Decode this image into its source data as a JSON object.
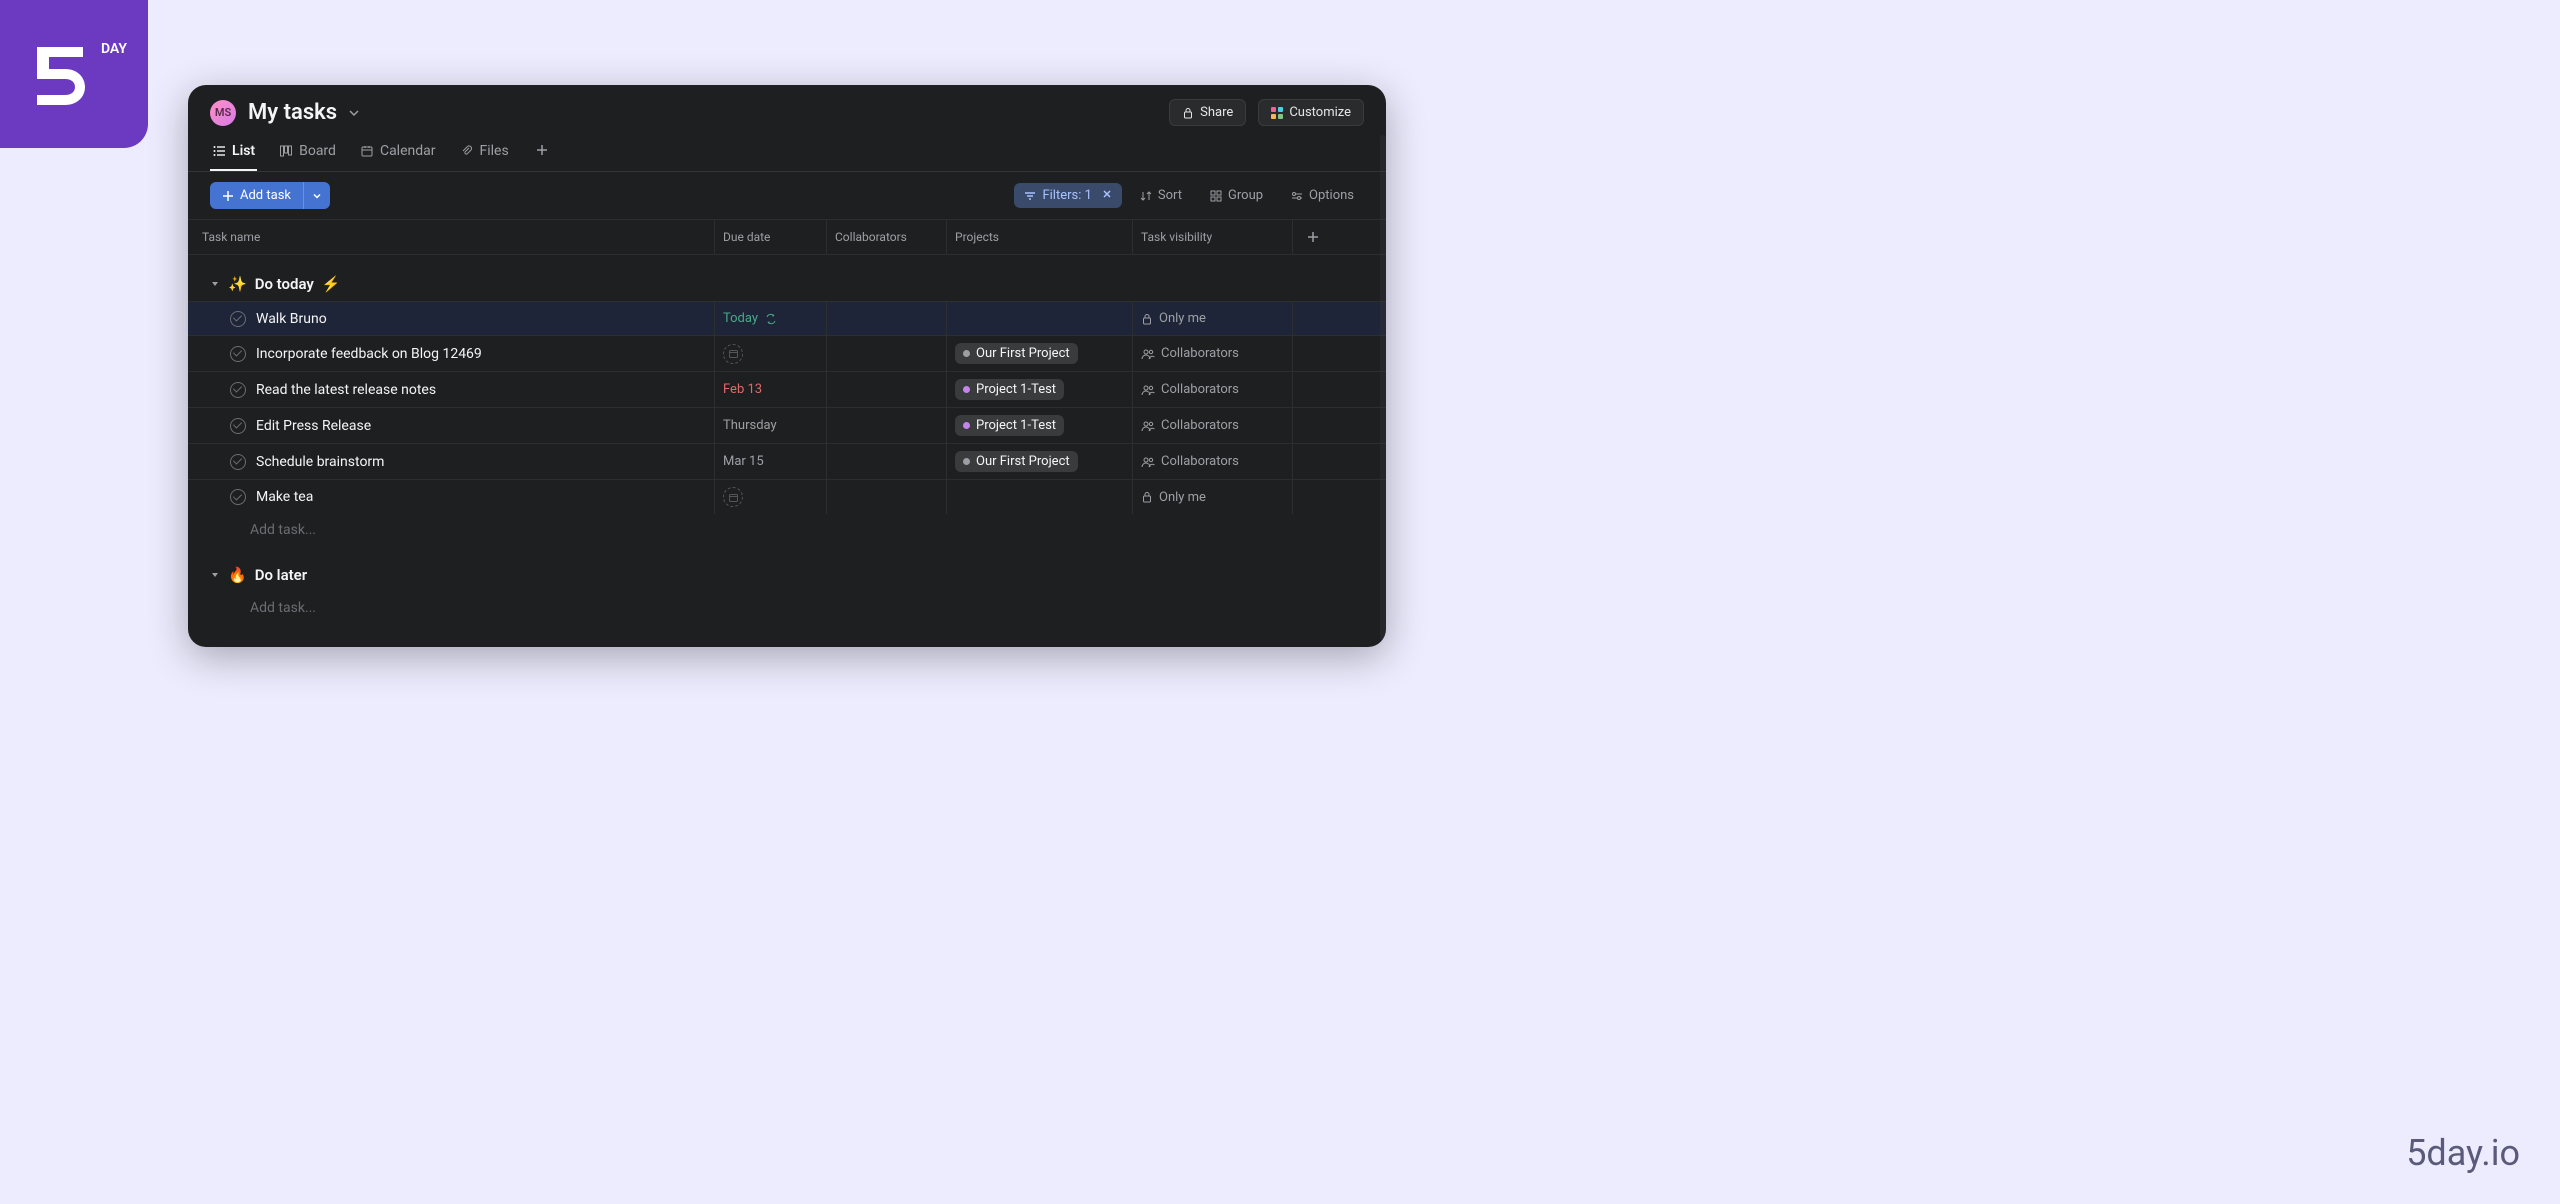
{
  "branding": {
    "logo_main": "5",
    "logo_sub": "DAY",
    "watermark": "5day.io"
  },
  "header": {
    "avatar_initials": "MS",
    "title": "My tasks",
    "share_label": "Share",
    "customize_label": "Customize"
  },
  "tabs": {
    "list": "List",
    "board": "Board",
    "calendar": "Calendar",
    "files": "Files"
  },
  "toolbar": {
    "add_task": "Add task",
    "filters": "Filters: 1",
    "sort": "Sort",
    "group": "Group",
    "options": "Options"
  },
  "columns": {
    "task_name": "Task name",
    "due_date": "Due date",
    "collaborators": "Collaborators",
    "projects": "Projects",
    "visibility": "Task visibility"
  },
  "sections": [
    {
      "emoji_prefix": "✨",
      "name": "Do today",
      "emoji_suffix": "⚡",
      "tasks": [
        {
          "name": "Walk Bruno",
          "due": "Today",
          "due_class": "due-today",
          "recur": true,
          "project": null,
          "visibility": "Only me",
          "vis_icon": "lock"
        },
        {
          "name": "Incorporate feedback on Blog 12469",
          "due": null,
          "project": "Our First Project",
          "proj_dot": "dot-gray",
          "visibility": "Collaborators",
          "vis_icon": "people"
        },
        {
          "name": "Read the latest release notes",
          "due": "Feb 13",
          "due_class": "due-red",
          "project": "Project 1-Test",
          "proj_dot": "dot-purple",
          "visibility": "Collaborators",
          "vis_icon": "people"
        },
        {
          "name": "Edit Press Release",
          "due": "Thursday",
          "due_class": "due-gray",
          "project": "Project 1-Test",
          "proj_dot": "dot-purple",
          "visibility": "Collaborators",
          "vis_icon": "people"
        },
        {
          "name": "Schedule brainstorm",
          "due": "Mar 15",
          "due_class": "due-gray",
          "project": "Our First Project",
          "proj_dot": "dot-gray",
          "visibility": "Collaborators",
          "vis_icon": "people"
        },
        {
          "name": "Make tea",
          "due": null,
          "project": null,
          "visibility": "Only me",
          "vis_icon": "lock"
        }
      ],
      "add_task_placeholder": "Add task..."
    },
    {
      "emoji_prefix": "🔥",
      "name": "Do later",
      "tasks": [],
      "add_task_placeholder": "Add task..."
    }
  ]
}
